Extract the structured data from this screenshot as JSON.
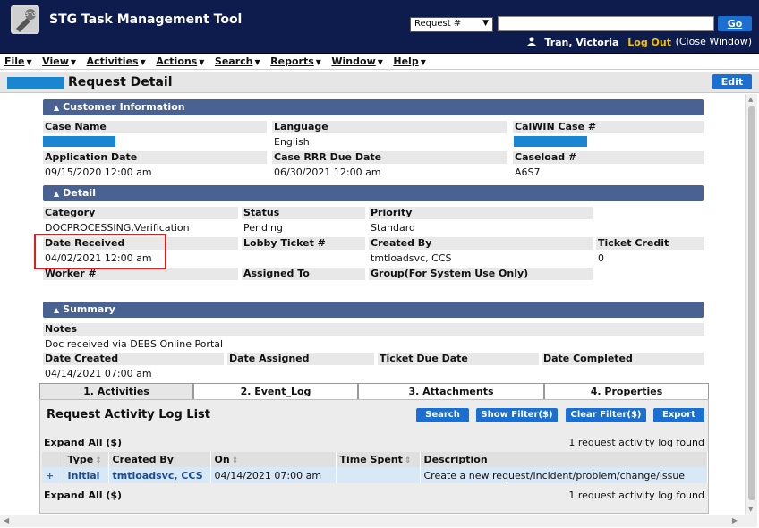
{
  "header": {
    "app_title": "STG Task Management Tool",
    "search_select": "Request #",
    "go_label": "Go",
    "user_name": "Tran, Victoria",
    "logout_label": "Log Out",
    "close_window": "(Close Window)"
  },
  "menu": [
    "File",
    "View",
    "Activities",
    "Actions",
    "Search",
    "Reports",
    "Window",
    "Help"
  ],
  "page": {
    "title": "Request Detail",
    "edit_label": "Edit"
  },
  "customer_info": {
    "header": "Customer Information",
    "case_name_label": "Case Name",
    "language_label": "Language",
    "language_value": "English",
    "calwin_label": "CalWIN Case #",
    "application_date_label": "Application Date",
    "application_date_value": "09/15/2020 12:00 am",
    "rrr_due_label": "Case RRR Due Date",
    "rrr_due_value": "06/30/2021 12:00 am",
    "caseload_label": "Caseload #",
    "caseload_value": "A6S7"
  },
  "detail": {
    "header": "Detail",
    "category_label": "Category",
    "category_value": "DOCPROCESSING,Verification",
    "status_label": "Status",
    "status_value": "Pending",
    "priority_label": "Priority",
    "priority_value": "Standard",
    "date_received_label": "Date Received",
    "date_received_value": "04/02/2021 12:00 am",
    "lobby_ticket_label": "Lobby Ticket #",
    "created_by_label": "Created By",
    "created_by_value": "tmtloadsvc, CCS",
    "ticket_credit_label": "Ticket Credit",
    "ticket_credit_value": "0",
    "worker_label": "Worker #",
    "assigned_to_label": "Assigned To",
    "group_label": "Group(For System Use Only)"
  },
  "summary": {
    "header": "Summary",
    "notes_label": "Notes",
    "notes_value": "Doc received via DEBS Online Portal",
    "date_created_label": "Date Created",
    "date_created_value": "04/14/2021 07:00 am",
    "date_assigned_label": "Date Assigned",
    "ticket_due_label": "Ticket Due Date",
    "date_completed_label": "Date Completed"
  },
  "tabs": [
    {
      "label": "1. Activities"
    },
    {
      "label": "2. Event_Log"
    },
    {
      "label": "3. Attachments"
    },
    {
      "label": "4. Properties"
    }
  ],
  "activity": {
    "title": "Request Activity Log List",
    "search_label": "Search",
    "show_filter_label": "Show Filter($)",
    "clear_filter_label": "Clear Filter($)",
    "export_label": "Export",
    "expand_all_label": "Expand All ($)",
    "found_text": "1 request activity log found",
    "columns": [
      "Type",
      "Created By",
      "On",
      "Time Spent",
      "Description"
    ],
    "rows": [
      {
        "type": "Initial",
        "created_by": "tmtloadsvc, CCS",
        "on": "04/14/2021 07:00 am",
        "time_spent": "",
        "description": "Create a new request/incident/problem/change/issue"
      }
    ]
  },
  "colors": {
    "header_bg": "#0e1b4d",
    "section_header": "#4a6291",
    "button_blue": "#1a6fd1",
    "highlight_red": "#e41b1b",
    "redaction_blue": "#1a86d1"
  }
}
